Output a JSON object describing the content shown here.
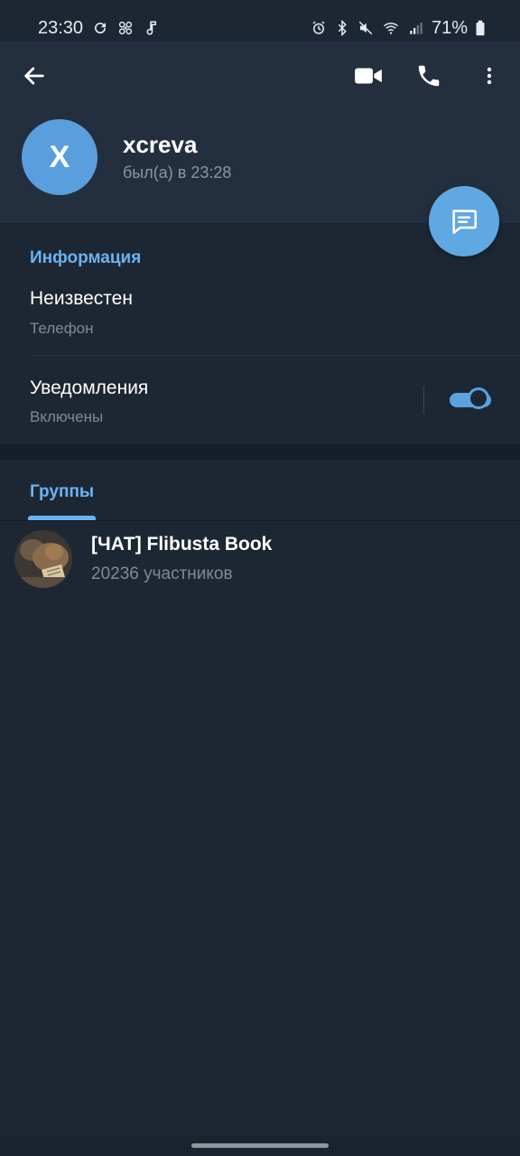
{
  "status_bar": {
    "time": "23:30",
    "battery_percent": "71%",
    "left_icons": [
      "sync-icon",
      "fan-icon",
      "music-note-icon"
    ],
    "right_icons": [
      "alarm-icon",
      "bluetooth-icon",
      "mute-icon",
      "wifi-icon",
      "signal-icon",
      "battery-icon"
    ]
  },
  "header": {
    "back_icon": "arrow-left-icon",
    "video_icon": "video-camera-icon",
    "call_icon": "phone-icon",
    "more_icon": "more-vertical-icon"
  },
  "profile": {
    "avatar_letter": "X",
    "avatar_color": "#5a9fdd",
    "name": "xcreva",
    "last_seen": "был(а) в 23:28"
  },
  "fab": {
    "icon": "message-icon",
    "color": "#5fa8e3"
  },
  "info": {
    "title": "Информация",
    "phone_value": "Неизвестен",
    "phone_label": "Телефон",
    "notifications_label": "Уведомления",
    "notifications_status": "Включены",
    "notifications_enabled": true
  },
  "groups": {
    "tab_label": "Группы",
    "items": [
      {
        "name": "[ЧАТ] Flibusta Book",
        "members": "20236 участников"
      }
    ]
  },
  "colors": {
    "accent": "#6ab3f3",
    "background": "#1d2733",
    "header_background": "#232f3e"
  }
}
